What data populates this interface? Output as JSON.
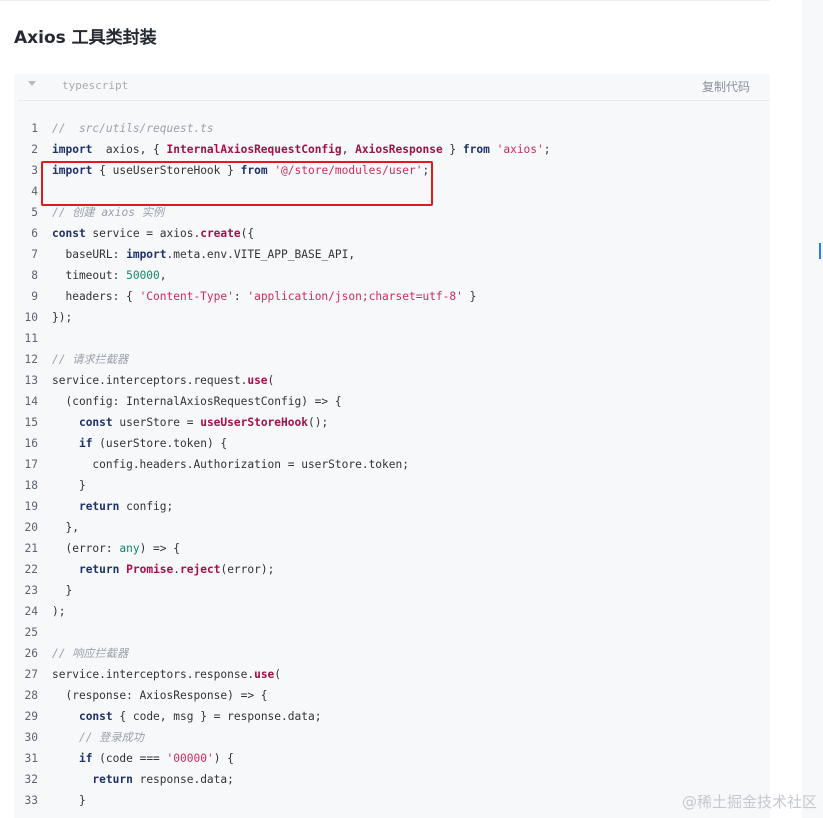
{
  "heading": "Axios 工具类封装",
  "code_block": {
    "language": "typescript",
    "copy_label": "复制代码",
    "lines": [
      [
        [
          "cm",
          "//  src/utils/request.ts"
        ]
      ],
      [
        [
          "kw",
          "import"
        ],
        [
          "",
          "  axios, { "
        ],
        [
          "fn",
          "InternalAxiosRequestConfig"
        ],
        [
          "",
          ", "
        ],
        [
          "fn",
          "AxiosResponse"
        ],
        [
          "",
          " } "
        ],
        [
          "kw",
          "from"
        ],
        [
          "",
          " "
        ],
        [
          "str",
          "'axios'"
        ],
        [
          "",
          ";"
        ]
      ],
      [
        [
          "kw",
          "import"
        ],
        [
          "",
          " { useUserStoreHook } "
        ],
        [
          "kw",
          "from"
        ],
        [
          "",
          " "
        ],
        [
          "str",
          "'@/store/modules/user'"
        ],
        [
          "",
          ";"
        ]
      ],
      [],
      [
        [
          "cm",
          "// 创建 axios 实例"
        ]
      ],
      [
        [
          "kw",
          "const"
        ],
        [
          "",
          " service = axios."
        ],
        [
          "fn",
          "create"
        ],
        [
          "",
          "({"
        ]
      ],
      [
        [
          "",
          "  baseURL: "
        ],
        [
          "kw",
          "import"
        ],
        [
          "",
          ".meta.env.VITE_APP_BASE_API,"
        ]
      ],
      [
        [
          "",
          "  timeout: "
        ],
        [
          "num",
          "50000"
        ],
        [
          "",
          ","
        ]
      ],
      [
        [
          "",
          "  headers: { "
        ],
        [
          "str",
          "'Content-Type'"
        ],
        [
          "",
          ": "
        ],
        [
          "str",
          "'application/json;charset=utf-8'"
        ],
        [
          "",
          " }"
        ]
      ],
      [
        [
          "",
          "});"
        ]
      ],
      [],
      [
        [
          "cm",
          "// 请求拦截器"
        ]
      ],
      [
        [
          "",
          "service.interceptors.request."
        ],
        [
          "fn",
          "use"
        ],
        [
          "",
          "("
        ]
      ],
      [
        [
          "",
          "  (config: InternalAxiosRequestConfig) => {"
        ]
      ],
      [
        [
          "",
          "    "
        ],
        [
          "kw",
          "const"
        ],
        [
          "",
          " userStore = "
        ],
        [
          "fn",
          "useUserStoreHook"
        ],
        [
          "",
          "();"
        ]
      ],
      [
        [
          "",
          "    "
        ],
        [
          "kw",
          "if"
        ],
        [
          "",
          " (userStore.token) {"
        ]
      ],
      [
        [
          "",
          "      config.headers.Authorization = userStore.token;"
        ]
      ],
      [
        [
          "",
          "    }"
        ]
      ],
      [
        [
          "",
          "    "
        ],
        [
          "kw",
          "return"
        ],
        [
          "",
          " config;"
        ]
      ],
      [
        [
          "",
          "  },"
        ]
      ],
      [
        [
          "",
          "  (error: "
        ],
        [
          "num",
          "any"
        ],
        [
          "",
          ") => {"
        ]
      ],
      [
        [
          "",
          "    "
        ],
        [
          "kw",
          "return"
        ],
        [
          "",
          " "
        ],
        [
          "fn",
          "Promise"
        ],
        [
          "",
          "."
        ],
        [
          "fn",
          "reject"
        ],
        [
          "",
          "(error);"
        ]
      ],
      [
        [
          "",
          "  }"
        ]
      ],
      [
        [
          "",
          ");"
        ]
      ],
      [],
      [
        [
          "cm",
          "// 响应拦截器"
        ]
      ],
      [
        [
          "",
          "service.interceptors.response."
        ],
        [
          "fn",
          "use"
        ],
        [
          "",
          "("
        ]
      ],
      [
        [
          "",
          "  (response: AxiosResponse) => {"
        ]
      ],
      [
        [
          "",
          "    "
        ],
        [
          "kw",
          "const"
        ],
        [
          "",
          " { code, msg } = response.data;"
        ]
      ],
      [
        [
          "",
          "    "
        ],
        [
          "cm",
          "// 登录成功"
        ]
      ],
      [
        [
          "",
          "    "
        ],
        [
          "kw",
          "if"
        ],
        [
          "",
          " (code === "
        ],
        [
          "str",
          "'00000'"
        ],
        [
          "",
          ") {"
        ]
      ],
      [
        [
          "",
          "      "
        ],
        [
          "kw",
          "return"
        ],
        [
          "",
          " response.data;"
        ]
      ],
      [
        [
          "",
          "    }"
        ]
      ]
    ]
  },
  "watermark": "@稀土掘金技术社区"
}
